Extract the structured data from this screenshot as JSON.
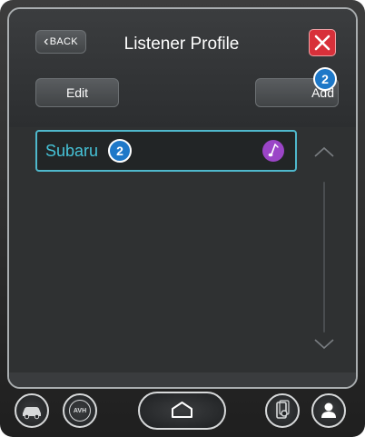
{
  "header": {
    "back_label": "BACK",
    "title": "Listener Profile",
    "close_icon": "close-icon"
  },
  "actions": {
    "edit_label": "Edit",
    "add_label": "Add",
    "add_badge": "2"
  },
  "profiles": [
    {
      "name": "Subaru",
      "badge": "2",
      "icon": "music-note-icon"
    }
  ],
  "scroll": {
    "up_icon": "chevron-up-icon",
    "down_icon": "chevron-down-icon"
  },
  "nav": {
    "items": [
      "car-icon",
      "avh-icon",
      "home-icon",
      "phone-settings-icon",
      "user-icon"
    ],
    "avh_label": "AVH"
  },
  "colors": {
    "accent": "#46c3d8",
    "badge": "#1e78c8",
    "close": "#d8303a",
    "music_icon": "#9b45c7"
  }
}
